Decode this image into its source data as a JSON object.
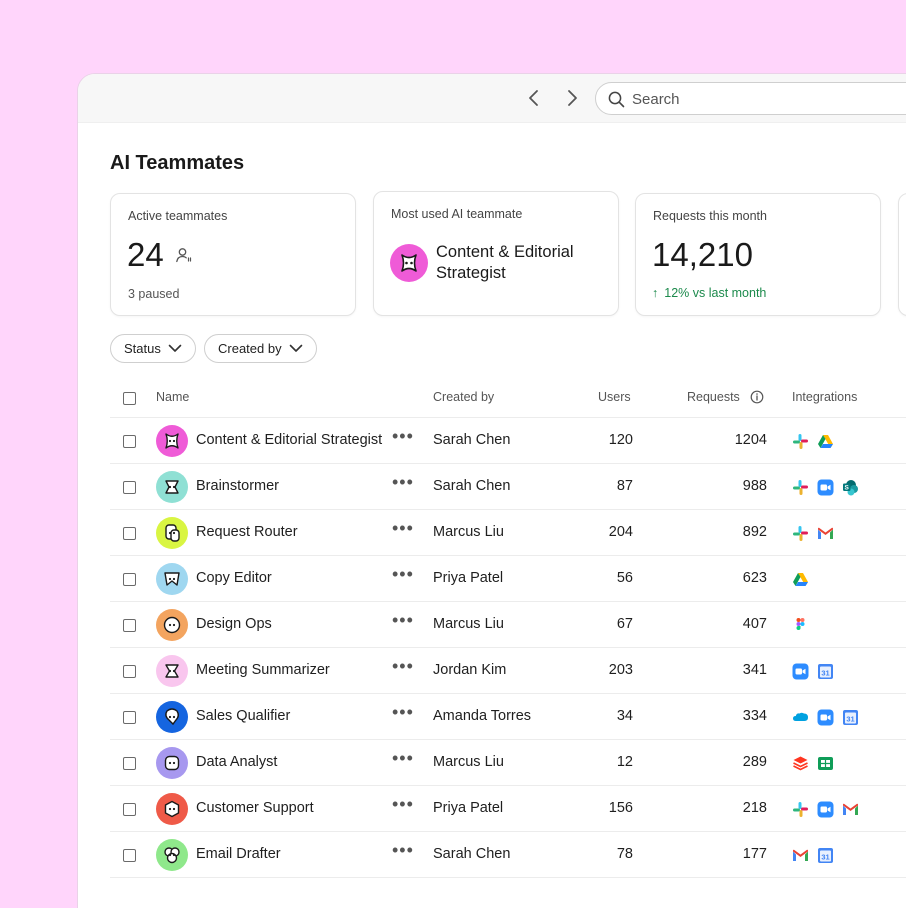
{
  "search": {
    "placeholder": "Search"
  },
  "page": {
    "title": "AI Teammates"
  },
  "stats": {
    "active": {
      "label": "Active teammates",
      "value": "24",
      "sub": "3 paused"
    },
    "most_used": {
      "label": "Most used AI teammate",
      "name": "Content & Editorial Strategist",
      "avatar_color": "#ef5bd7"
    },
    "requests": {
      "label": "Requests this month",
      "value": "14,210",
      "trend": "12% vs last month",
      "trend_color": "#1c8a4c"
    }
  },
  "filters": {
    "status": "Status",
    "created_by": "Created by"
  },
  "table": {
    "columns": {
      "name": "Name",
      "created_by": "Created by",
      "users": "Users",
      "requests": "Requests",
      "integrations": "Integrations"
    },
    "rows": [
      {
        "name": "Content & Editorial Strategist",
        "creator": "Sarah Chen",
        "users": "120",
        "requests": "1204",
        "avatar_color": "#ef5bd7",
        "integrations": [
          "slack-icon",
          "google-drive-icon"
        ]
      },
      {
        "name": "Brainstormer",
        "creator": "Sarah Chen",
        "users": "87",
        "requests": "988",
        "avatar_color": "#8fe0d4",
        "integrations": [
          "slack-icon",
          "zoom-icon",
          "sharepoint-icon"
        ]
      },
      {
        "name": "Request Router",
        "creator": "Marcus Liu",
        "users": "204",
        "requests": "892",
        "avatar_color": "#d9f542",
        "integrations": [
          "slack-icon",
          "gmail-icon"
        ]
      },
      {
        "name": "Copy Editor",
        "creator": "Priya Patel",
        "users": "56",
        "requests": "623",
        "avatar_color": "#9fd7f0",
        "integrations": [
          "google-drive-icon"
        ]
      },
      {
        "name": "Design Ops",
        "creator": "Marcus Liu",
        "users": "67",
        "requests": "407",
        "avatar_color": "#f3a45f",
        "integrations": [
          "figma-icon"
        ]
      },
      {
        "name": "Meeting Summarizer",
        "creator": "Jordan Kim",
        "users": "203",
        "requests": "341",
        "avatar_color": "#f9c6ee",
        "integrations": [
          "zoom-icon",
          "google-calendar-icon"
        ]
      },
      {
        "name": "Sales Qualifier",
        "creator": "Amanda Torres",
        "users": "34",
        "requests": "334",
        "avatar_color": "#1565e0",
        "integrations": [
          "salesforce-icon",
          "zoom-icon",
          "google-calendar-icon"
        ]
      },
      {
        "name": "Data Analyst",
        "creator": "Marcus Liu",
        "users": "12",
        "requests": "289",
        "avatar_color": "#a798ef",
        "integrations": [
          "databricks-icon",
          "google-sheets-icon"
        ]
      },
      {
        "name": "Customer Support",
        "creator": "Priya Patel",
        "users": "156",
        "requests": "218",
        "avatar_color": "#ef5a48",
        "integrations": [
          "slack-icon",
          "zoom-icon",
          "gmail-icon"
        ]
      },
      {
        "name": "Email Drafter",
        "creator": "Sarah Chen",
        "users": "78",
        "requests": "177",
        "avatar_color": "#8fe88b",
        "integrations": [
          "gmail-icon",
          "google-calendar-icon"
        ]
      }
    ]
  },
  "colors": {
    "background": "#ffd5fb",
    "accent_trend": "#1c8a4c"
  }
}
